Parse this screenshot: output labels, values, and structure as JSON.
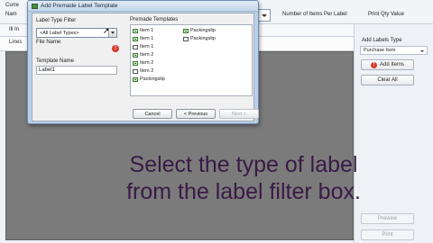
{
  "app": {
    "cut_labels": [
      "Curre",
      "Nam"
    ],
    "columns": [
      "Number of Items Per Label",
      "Print Qty Value"
    ],
    "tab_partial": "Ill  In",
    "grid_header_partial": "Lines"
  },
  "right_panel": {
    "add_labels_type_label": "Add Labels Type",
    "add_labels_type_value": "Purchase Item",
    "add_items_label": "Add Items",
    "clear_all_label": "Clear All",
    "preview_label": "Preview",
    "print_label": "Print",
    "error_glyph": "!"
  },
  "dialog": {
    "title": "Add Premade Label Template",
    "label_type_filter_label": "Label Type Filter",
    "label_type_filter_value": "<All Label Types>",
    "file_name_label": "File Name",
    "file_name_error_glyph": "!",
    "template_name_label": "Template Name",
    "template_name_value": "Label1",
    "premade_templates_label": "Premade Templates",
    "templates_col1": [
      "Item 1",
      "Item 1",
      "Item 1",
      "Item 2",
      "Item 2",
      "Item 2",
      "Packingslip"
    ],
    "templates_col2": [
      "Packingslip",
      "Packingslip"
    ],
    "cancel_label": "Cancel",
    "previous_label": "< Previous",
    "next_label": "Next >"
  },
  "caption": {
    "line1": "Select the type of label",
    "line2": "from the label filter box."
  }
}
